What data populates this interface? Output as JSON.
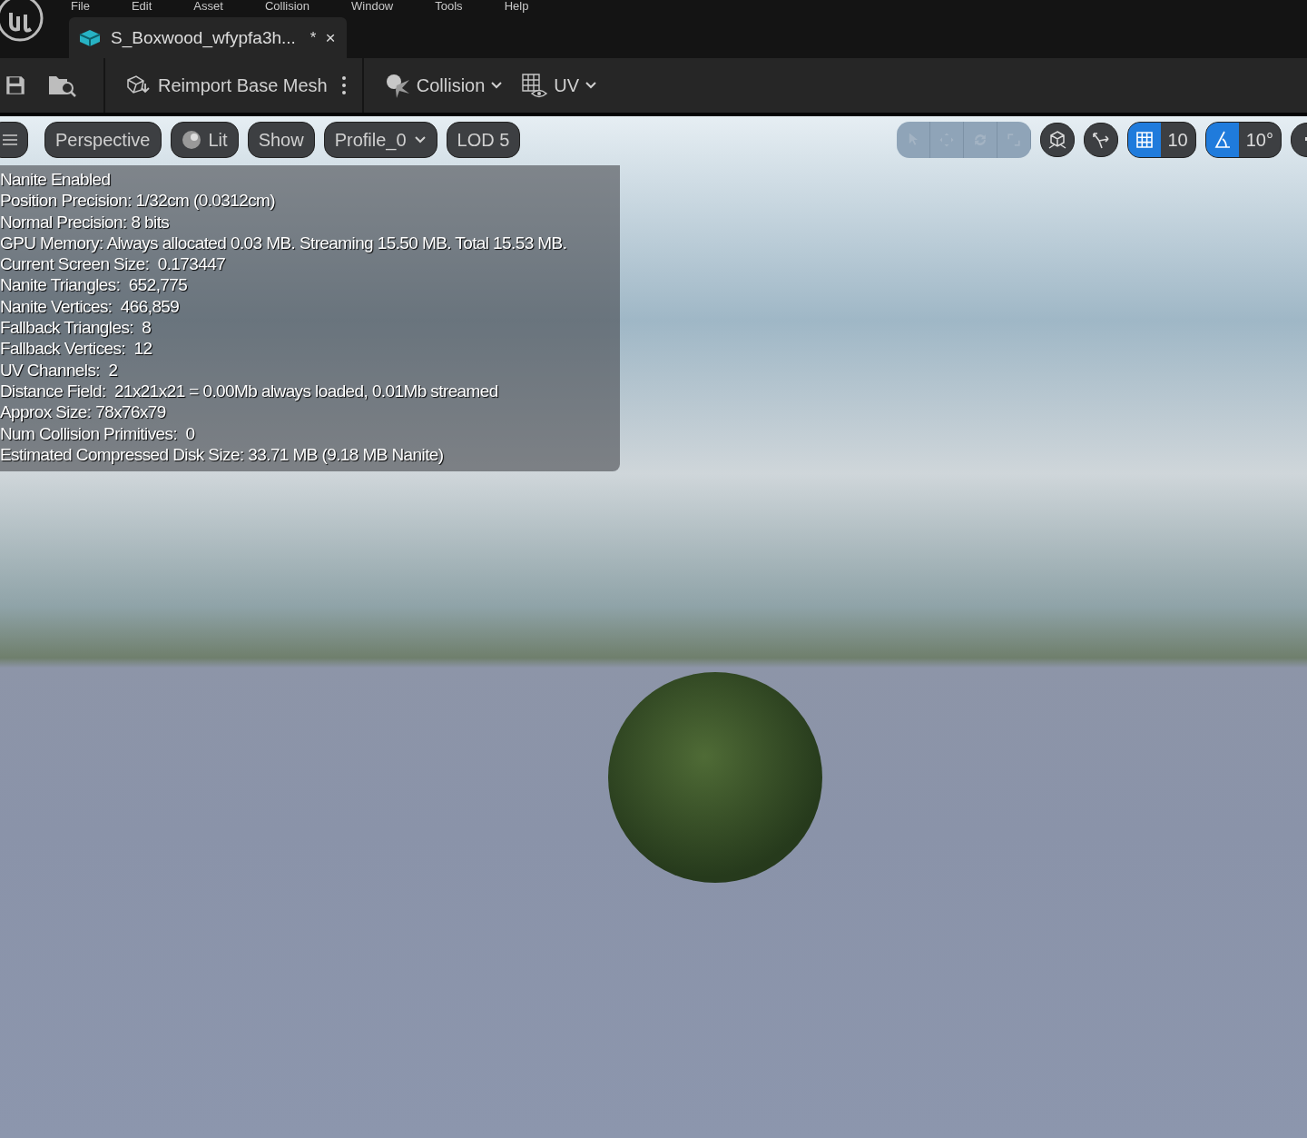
{
  "menu": [
    "File",
    "Edit",
    "Asset",
    "Collision",
    "Window",
    "Tools",
    "Help"
  ],
  "tab": {
    "title": "S_Boxwood_wfypfa3h...",
    "modified_mark": "*",
    "close": "×"
  },
  "toolbar": [
    {
      "kind": "icon"
    },
    {
      "kind": "icon"
    },
    {
      "kind": "sep"
    },
    {
      "kind": "action",
      "label": "Reimport Base Mesh"
    },
    {
      "kind": "more"
    },
    {
      "kind": "sep"
    },
    {
      "kind": "dropdown",
      "label": "Collision"
    },
    {
      "kind": "dropdown",
      "label": "UV"
    }
  ],
  "viewport_toolbar": {
    "left": [
      {
        "kind": "menu"
      },
      {
        "kind": "pill",
        "label": "Perspective"
      },
      {
        "kind": "lit",
        "label": "Lit"
      },
      {
        "kind": "pill",
        "label": "Show"
      },
      {
        "kind": "dropdown",
        "label": "Profile_0"
      },
      {
        "kind": "pill",
        "label": "LOD 5"
      }
    ],
    "transform_tools": [
      {
        "disabled": true
      },
      {
        "disabled": true
      },
      {
        "disabled": true
      },
      {
        "disabled": true
      }
    ],
    "grid_snap": {
      "on": true,
      "value": "10"
    },
    "angle_snap": {
      "on": true,
      "value": "10°"
    }
  },
  "stats": [
    "Nanite Enabled",
    "Position Precision: 1/32cm (0.0312cm)",
    "Normal Precision: 8 bits",
    "GPU Memory: Always allocated 0.03 MB. Streaming 15.50 MB. Total 15.53 MB.",
    "Current Screen Size:  0.173447",
    "Nanite Triangles:  652,775",
    "Nanite Vertices:  466,859",
    "Fallback Triangles:  8",
    "Fallback Vertices:  12",
    "UV Channels:  2",
    "Distance Field:  21x21x21 = 0.00Mb always loaded, 0.01Mb streamed",
    "Approx Size: 78x76x79",
    "Num Collision Primitives:  0",
    "Estimated Compressed Disk Size: 33.71 MB (9.18 MB Nanite)"
  ]
}
